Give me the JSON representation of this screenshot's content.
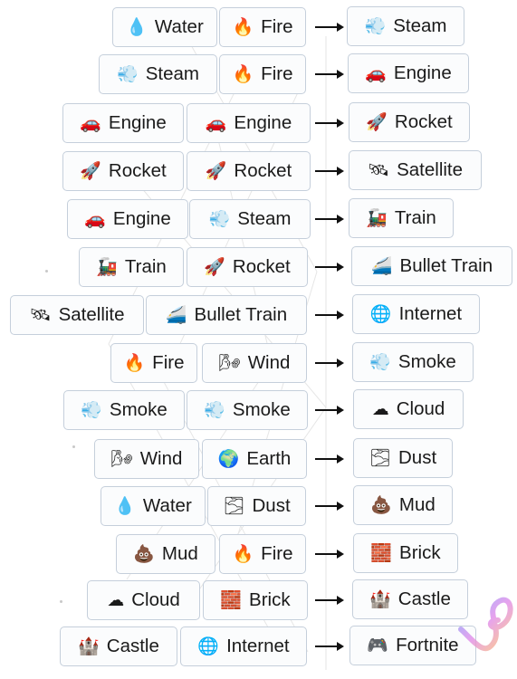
{
  "recipes": [
    {
      "a": {
        "emoji": "💧",
        "label": "Water"
      },
      "b": {
        "emoji": "🔥",
        "label": "Fire"
      },
      "r": {
        "emoji": "💨",
        "label": "Steam"
      }
    },
    {
      "a": {
        "emoji": "💨",
        "label": "Steam"
      },
      "b": {
        "emoji": "🔥",
        "label": "Fire"
      },
      "r": {
        "emoji": "🚗",
        "label": "Engine"
      }
    },
    {
      "a": {
        "emoji": "🚗",
        "label": "Engine"
      },
      "b": {
        "emoji": "🚗",
        "label": "Engine"
      },
      "r": {
        "emoji": "🚀",
        "label": "Rocket"
      }
    },
    {
      "a": {
        "emoji": "🚀",
        "label": "Rocket"
      },
      "b": {
        "emoji": "🚀",
        "label": "Rocket"
      },
      "r": {
        "emoji": "🛰",
        "label": "Satellite"
      }
    },
    {
      "a": {
        "emoji": "🚗",
        "label": "Engine"
      },
      "b": {
        "emoji": "💨",
        "label": "Steam"
      },
      "r": {
        "emoji": "🚂",
        "label": "Train"
      }
    },
    {
      "a": {
        "emoji": "🚂",
        "label": "Train"
      },
      "b": {
        "emoji": "🚀",
        "label": "Rocket"
      },
      "r": {
        "emoji": "🚄",
        "label": "Bullet Train"
      }
    },
    {
      "a": {
        "emoji": "🛰",
        "label": "Satellite"
      },
      "b": {
        "emoji": "🚄",
        "label": "Bullet Train"
      },
      "r": {
        "emoji": "🌐",
        "label": "Internet"
      }
    },
    {
      "a": {
        "emoji": "🔥",
        "label": "Fire"
      },
      "b": {
        "emoji": "🌬",
        "label": "Wind"
      },
      "r": {
        "emoji": "💨",
        "label": "Smoke"
      }
    },
    {
      "a": {
        "emoji": "💨",
        "label": "Smoke"
      },
      "b": {
        "emoji": "💨",
        "label": "Smoke"
      },
      "r": {
        "emoji": "☁",
        "label": "Cloud"
      }
    },
    {
      "a": {
        "emoji": "🌬",
        "label": "Wind"
      },
      "b": {
        "emoji": "🌍",
        "label": "Earth"
      },
      "r": {
        "emoji": "🌫",
        "label": "Dust"
      }
    },
    {
      "a": {
        "emoji": "💧",
        "label": "Water"
      },
      "b": {
        "emoji": "🌫",
        "label": "Dust"
      },
      "r": {
        "emoji": "💩",
        "label": "Mud"
      }
    },
    {
      "a": {
        "emoji": "💩",
        "label": "Mud"
      },
      "b": {
        "emoji": "🔥",
        "label": "Fire"
      },
      "r": {
        "emoji": "🧱",
        "label": "Brick"
      }
    },
    {
      "a": {
        "emoji": "☁",
        "label": "Cloud"
      },
      "b": {
        "emoji": "🧱",
        "label": "Brick"
      },
      "r": {
        "emoji": "🏰",
        "label": "Castle"
      }
    },
    {
      "a": {
        "emoji": "🏰",
        "label": "Castle"
      },
      "b": {
        "emoji": "🌐",
        "label": "Internet"
      },
      "r": {
        "emoji": "🎮",
        "label": "Fortnite"
      }
    }
  ],
  "colors": {
    "tile_border": "#c5cfdb",
    "tile_bg": "#fbfcfd",
    "arrow": "#111111"
  }
}
